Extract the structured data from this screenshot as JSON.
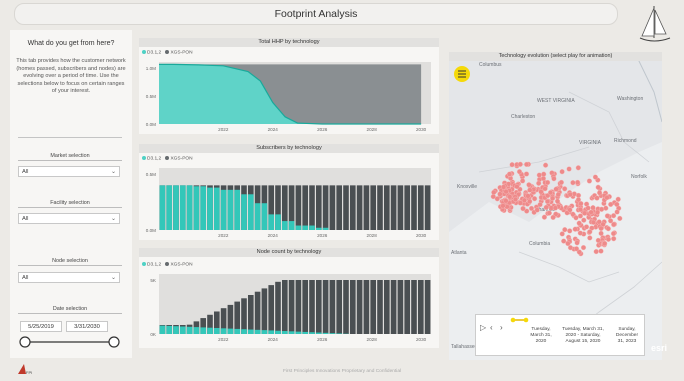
{
  "header": {
    "title": "Footprint Analysis"
  },
  "left": {
    "heading": "What do you get from here?",
    "description": "This tab provides how the customer network (homes passed, subscribers and nodes) are evolving over a period of time. Use the selections below to focus on certain ranges of your interest.",
    "market": {
      "label": "Market selection",
      "value": "All"
    },
    "facility": {
      "label": "Facility selection",
      "value": "All"
    },
    "node": {
      "label": "Node selection",
      "value": "All"
    },
    "date": {
      "label": "Date selection",
      "start": "5/25/2019",
      "end": "3/31/2030"
    }
  },
  "chart_data": [
    {
      "type": "area",
      "title": "Total HHP by technology",
      "legend": [
        "D3.1,2",
        "XGS-PON"
      ],
      "colors": {
        "D3.1,2": "#4fd1c5",
        "XGS-PON": "#666b6e"
      },
      "x": [
        2019.4,
        2020,
        2021,
        2022,
        2023,
        2023.5,
        2024,
        2024.5,
        2025,
        2026,
        2027,
        2028,
        2029,
        2030
      ],
      "series": [
        {
          "name": "D3.1,2",
          "values": [
            1.25,
            1.25,
            1.24,
            1.22,
            1.1,
            0.9,
            0.45,
            0.15,
            0.02,
            0,
            0,
            0,
            0,
            0
          ]
        },
        {
          "name": "XGS-PON",
          "values": [
            0,
            0,
            0.01,
            0.03,
            0.15,
            0.35,
            0.8,
            1.1,
            1.23,
            1.25,
            1.25,
            1.25,
            1.25,
            1.25
          ]
        }
      ],
      "yticks": [
        "0.0M",
        "0.5M",
        "1.0M"
      ],
      "xticks": [
        "2022",
        "2024",
        "2026",
        "2028",
        "2030"
      ]
    },
    {
      "type": "bar",
      "title": "Subscribers by technology",
      "legend": [
        "D3.1,2",
        "XGS-PON"
      ],
      "x_start": 2019.4,
      "x_end": 2030.3,
      "bars": 40,
      "total": 0.95,
      "d31_share_pattern": [
        1,
        1,
        0.98,
        0.95,
        0.9,
        0.8,
        0.6,
        0.35,
        0.2,
        0.1,
        0.05,
        0
      ],
      "yticks": [
        "0.0M",
        "0.5M"
      ],
      "xticks": [
        "2022",
        "2024",
        "2026",
        "2028",
        "2030"
      ]
    },
    {
      "type": "bar",
      "title": "Node count by technology",
      "legend": [
        "D3.1,2",
        "XGS-PON"
      ],
      "x_start": 2019.4,
      "x_end": 2030.3,
      "bars": 40,
      "yticks": [
        "0K",
        "5K"
      ],
      "xticks": [
        "2022",
        "2024",
        "2026",
        "2028",
        "2030"
      ]
    }
  ],
  "map": {
    "title": "Technology evolution (select play for animation)",
    "places": [
      "Columbus",
      "Washington",
      "Charleston",
      "WEST VIRGINIA",
      "Richmond",
      "VIRGINIA",
      "Knoxville",
      "Charlotte",
      "Columbia",
      "Atlanta",
      "Norfolk",
      "Tallahassee"
    ],
    "timeline": [
      {
        "label": "Tuesday, March 31, 2020"
      },
      {
        "label": "Tuesday, March 31, 2020 - Saturday, August 15, 2020"
      },
      {
        "label": "Sunday, December 31, 2023"
      }
    ],
    "attribution": "esri"
  },
  "footer": {
    "text": "First Principles Innovations Proprietary and Confidential"
  }
}
